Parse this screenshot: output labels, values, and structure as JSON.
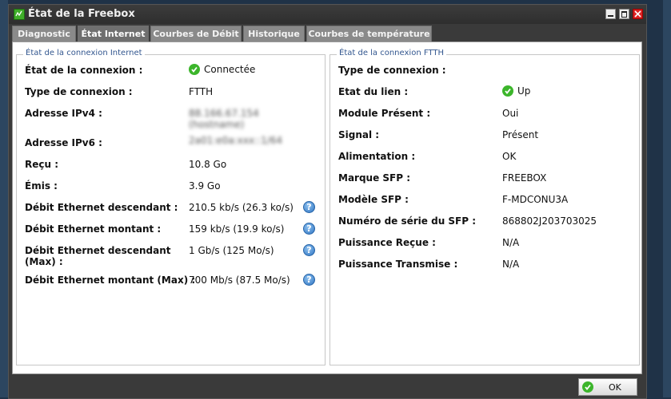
{
  "window": {
    "title": "État de la Freebox"
  },
  "tabs": [
    "Diagnostic",
    "État Internet",
    "Courbes de Débit",
    "Historique",
    "Courbes de température"
  ],
  "left_panel": {
    "legend": "État de la connexion Internet",
    "rows": [
      {
        "label": "État de la connexion :",
        "value": "Connectée"
      },
      {
        "label": "Type de connexion :",
        "value": "FTTH"
      },
      {
        "label": "Adresse IPv4 :",
        "value": "88.166.67.154 (hostname)"
      },
      {
        "label": "Adresse IPv6 :",
        "value": "2a01:e0a:xxx::1/64"
      },
      {
        "label": "Reçu :",
        "value": "10.8 Go"
      },
      {
        "label": "Émis :",
        "value": "3.9 Go"
      },
      {
        "label": "Débit Ethernet descendant :",
        "value": "210.5 kb/s (26.3 ko/s)"
      },
      {
        "label": "Débit Ethernet montant :",
        "value": "159 kb/s (19.9 ko/s)"
      },
      {
        "label": "Débit Ethernet descendant (Max) :",
        "value": "1 Gb/s (125 Mo/s)"
      },
      {
        "label": "Débit Ethernet montant (Max) :",
        "value": "700 Mb/s (87.5 Mo/s)"
      }
    ]
  },
  "right_panel": {
    "legend": "État de la connexion FTTH",
    "rows": [
      {
        "label": "Type de connexion :",
        "value": ""
      },
      {
        "label": "Etat du lien :",
        "value": "Up"
      },
      {
        "label": "Module Présent :",
        "value": "Oui"
      },
      {
        "label": "Signal :",
        "value": "Présent"
      },
      {
        "label": "Alimentation :",
        "value": "OK"
      },
      {
        "label": "Marque SFP :",
        "value": "FREEBOX"
      },
      {
        "label": "Modèle SFP :",
        "value": "F-MDCONU3A"
      },
      {
        "label": "Numéro de série du SFP :",
        "value": "868802J203703025"
      },
      {
        "label": "Puissance Reçue :",
        "value": "N/A"
      },
      {
        "label": "Puissance Transmise :",
        "value": "N/A"
      }
    ]
  },
  "footer": {
    "ok_label": "OK"
  },
  "colors": {
    "status_ok": "#3cb52b",
    "legend_text": "#33578f"
  }
}
